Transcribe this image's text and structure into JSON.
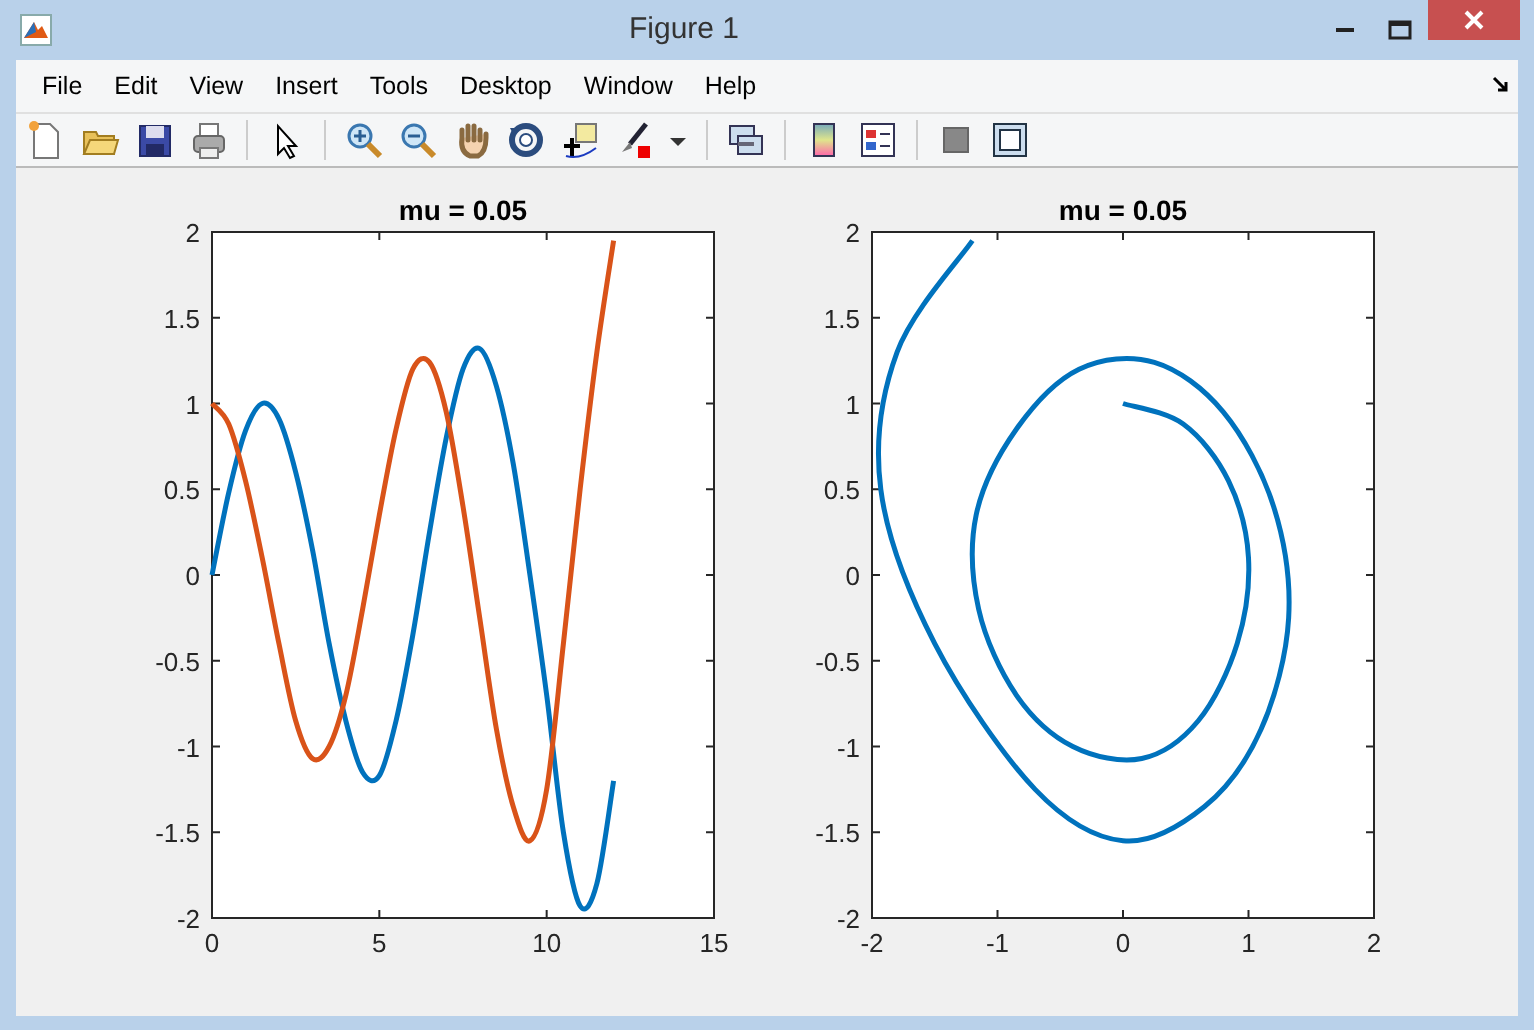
{
  "window": {
    "title": "Figure 1"
  },
  "menu": [
    "File",
    "Edit",
    "View",
    "Insert",
    "Tools",
    "Desktop",
    "Window",
    "Help"
  ],
  "charts": [
    {
      "chart_data": {
        "type": "line",
        "title": "mu = 0.05",
        "x": [
          0,
          0.5,
          1,
          1.5,
          2,
          2.5,
          3,
          3.5,
          4,
          4.5,
          5,
          5.5,
          6,
          6.5,
          7,
          7.5,
          8,
          8.5,
          9,
          9.5,
          10,
          10.5,
          11,
          11.5,
          12
        ],
        "series": [
          {
            "color": "#0072bd",
            "values": [
              0,
              0.48,
              0.84,
              1.0,
              0.91,
              0.6,
              0.15,
              -0.4,
              -0.85,
              -1.15,
              -1.17,
              -0.85,
              -0.35,
              0.25,
              0.8,
              1.2,
              1.32,
              1.1,
              0.65,
              0.0,
              -0.7,
              -1.5,
              -1.93,
              -1.8,
              -1.2
            ]
          },
          {
            "color": "#d95319",
            "values": [
              1,
              0.88,
              0.55,
              0.1,
              -0.4,
              -0.85,
              -1.07,
              -1.0,
              -0.7,
              -0.2,
              0.35,
              0.85,
              1.2,
              1.24,
              0.95,
              0.4,
              -0.25,
              -0.9,
              -1.35,
              -1.55,
              -1.25,
              -0.4,
              0.5,
              1.3,
              1.95
            ]
          }
        ],
        "xlim": [
          0,
          15
        ],
        "ylim": [
          -2,
          2
        ],
        "xticks": [
          0,
          5,
          10,
          15
        ],
        "yticks": [
          -2,
          -1.5,
          -1,
          -0.5,
          0,
          0.5,
          1,
          1.5,
          2
        ]
      }
    },
    {
      "chart_data": {
        "type": "line",
        "title": "mu = 0.05",
        "x": [
          0,
          0.48,
          0.84,
          1.0,
          0.91,
          0.6,
          0.15,
          -0.4,
          -0.85,
          -1.15,
          -1.17,
          -0.85,
          -0.35,
          0.25,
          0.8,
          1.2,
          1.32,
          1.1,
          0.65,
          0.0,
          -0.7,
          -1.5,
          -1.93,
          -1.8,
          -1.2
        ],
        "series": [
          {
            "color": "#0072bd",
            "values": [
              1,
              0.88,
              0.55,
              0.1,
              -0.4,
              -0.85,
              -1.07,
              -1.0,
              -0.7,
              -0.2,
              0.35,
              0.85,
              1.2,
              1.24,
              0.95,
              0.4,
              -0.25,
              -0.9,
              -1.35,
              -1.55,
              -1.25,
              -0.4,
              0.5,
              1.3,
              1.95
            ]
          }
        ],
        "xlim": [
          -2,
          2
        ],
        "ylim": [
          -2,
          2
        ],
        "xticks": [
          -2,
          -1,
          0,
          1,
          2
        ],
        "yticks": [
          -2,
          -1.5,
          -1,
          -0.5,
          0,
          0.5,
          1,
          1.5,
          2
        ]
      }
    }
  ]
}
